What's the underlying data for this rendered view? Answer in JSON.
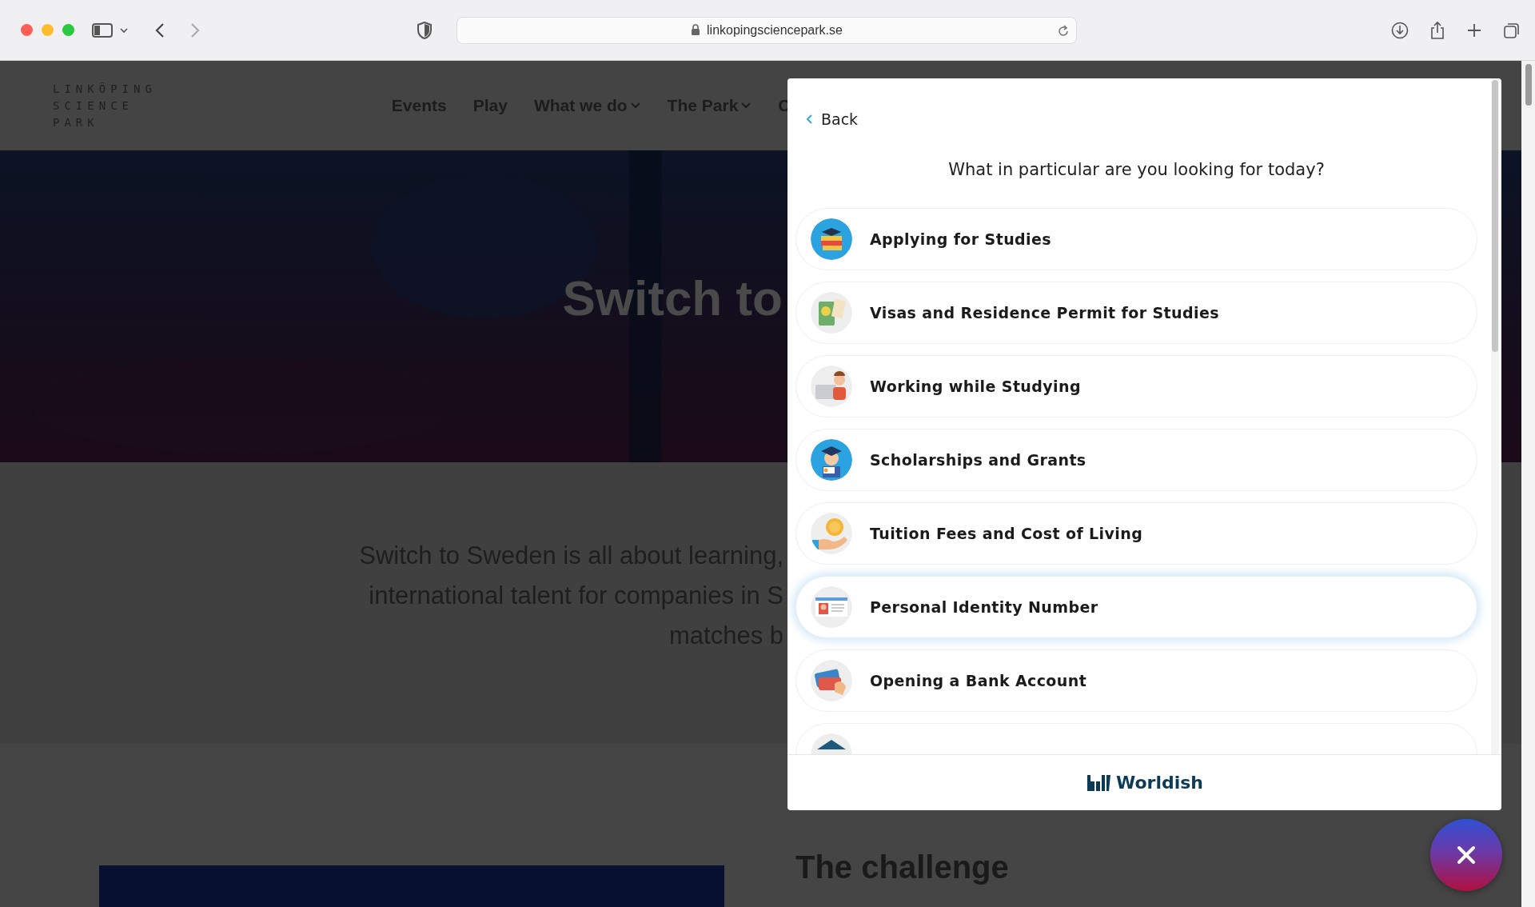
{
  "browser": {
    "address": "linkopingsciencepark.se"
  },
  "site": {
    "logo_lines": [
      "LINKÖPING",
      "SCIENCE",
      "PARK"
    ],
    "nav": [
      {
        "label": "Events",
        "has_menu": false
      },
      {
        "label": "Play",
        "has_menu": false
      },
      {
        "label": "What we do",
        "has_menu": true
      },
      {
        "label": "The Park",
        "has_menu": true
      },
      {
        "label": "C",
        "has_menu": false
      }
    ],
    "hero_title": "Switch to",
    "intro_lines": [
      "Switch to Sweden is all about learning,",
      "international talent for companies in S",
      "matches b"
    ],
    "section_heading": "The challenge"
  },
  "panel": {
    "back": "Back",
    "question": "What in particular are you looking for today?",
    "items": [
      {
        "label": "Applying for Studies",
        "selected": false
      },
      {
        "label": "Visas and Residence Permit for Studies",
        "selected": false
      },
      {
        "label": "Working while Studying",
        "selected": false
      },
      {
        "label": "Scholarships and Grants",
        "selected": false
      },
      {
        "label": "Tuition Fees and Cost of Living",
        "selected": false
      },
      {
        "label": "Personal Identity Number",
        "selected": true
      },
      {
        "label": "Opening a Bank Account",
        "selected": false
      }
    ],
    "brand": "Worldish"
  }
}
